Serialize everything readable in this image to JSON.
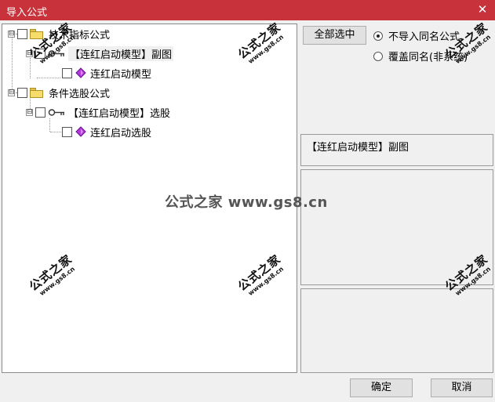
{
  "window": {
    "title": "导入公式",
    "close_glyph": "✕"
  },
  "tree": {
    "nodes": [
      {
        "label": "技术指标公式",
        "expander": "⊟"
      },
      {
        "label": "【连红启动模型】副图",
        "expander": "⊟"
      },
      {
        "label": "连红启动模型"
      },
      {
        "label": "条件选股公式",
        "expander": "⊟"
      },
      {
        "label": "【连红启动模型】选股",
        "expander": "⊟"
      },
      {
        "label": "连红启动选股"
      }
    ]
  },
  "buttons": {
    "select_all": "全部选中",
    "ok": "确定",
    "cancel": "取消"
  },
  "options": {
    "no_import_same_name": "不导入同名公式",
    "overwrite_same_name": "覆盖同名(非系统)",
    "selected_option": "no_import_same_name"
  },
  "info": {
    "selected_formula": "【连红启动模型】副图"
  },
  "watermark": {
    "brand": "公式之家",
    "url": "www.gs8.cn",
    "center": "公式之家 www.gs8.cn"
  },
  "icons": {
    "folder": "folder-icon",
    "key": "key-icon",
    "formula": "formula-gem-icon"
  },
  "colors": {
    "titlebar": "#c8323b",
    "gem": "#b03ad8"
  }
}
